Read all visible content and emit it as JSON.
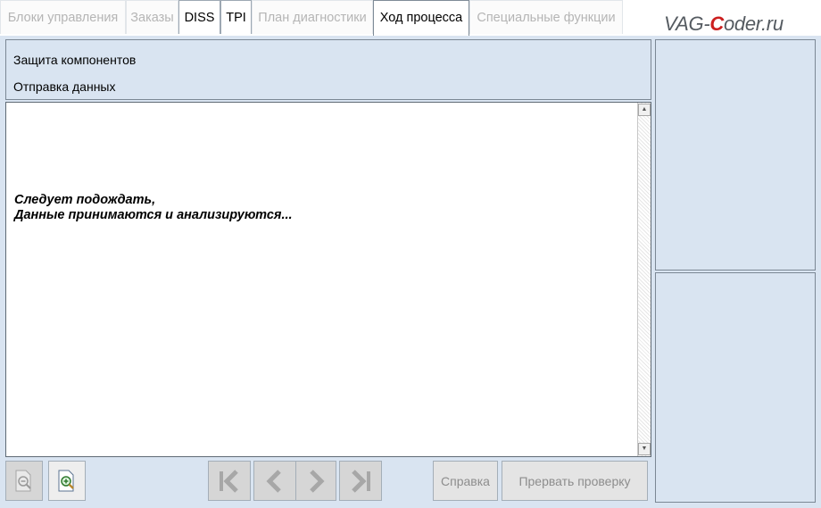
{
  "tabs": [
    {
      "label": "Блоки управления",
      "state": "disabled"
    },
    {
      "label": "Заказы",
      "state": "disabled"
    },
    {
      "label": "DISS",
      "state": "enabled"
    },
    {
      "label": "TPI",
      "state": "enabled"
    },
    {
      "label": "План диагностики",
      "state": "disabled"
    },
    {
      "label": "Ход процесса",
      "state": "active"
    },
    {
      "label": "Специальные функции",
      "state": "disabled"
    }
  ],
  "logo": {
    "prefix": "VAG-",
    "accent": "C",
    "suffix": "oder.ru"
  },
  "header": {
    "line1": "Защита компонентов",
    "line2": "Отправка данных"
  },
  "content": {
    "message_line1": "Следует подождать,",
    "message_line2": "Данные принимаются и анализируются..."
  },
  "toolbar": {
    "help_label": "Справка",
    "abort_label": "Прервать проверку"
  },
  "icons": {
    "zoom_out": "zoom-out-icon",
    "zoom_in": "zoom-in-icon",
    "first": "first-page-icon",
    "prev": "previous-icon",
    "next": "next-icon",
    "last": "last-page-icon"
  },
  "colors": {
    "panel_background": "#d9e4f1",
    "disabled_text": "#8d8d8d",
    "logo_accent": "#cc1f1f"
  }
}
